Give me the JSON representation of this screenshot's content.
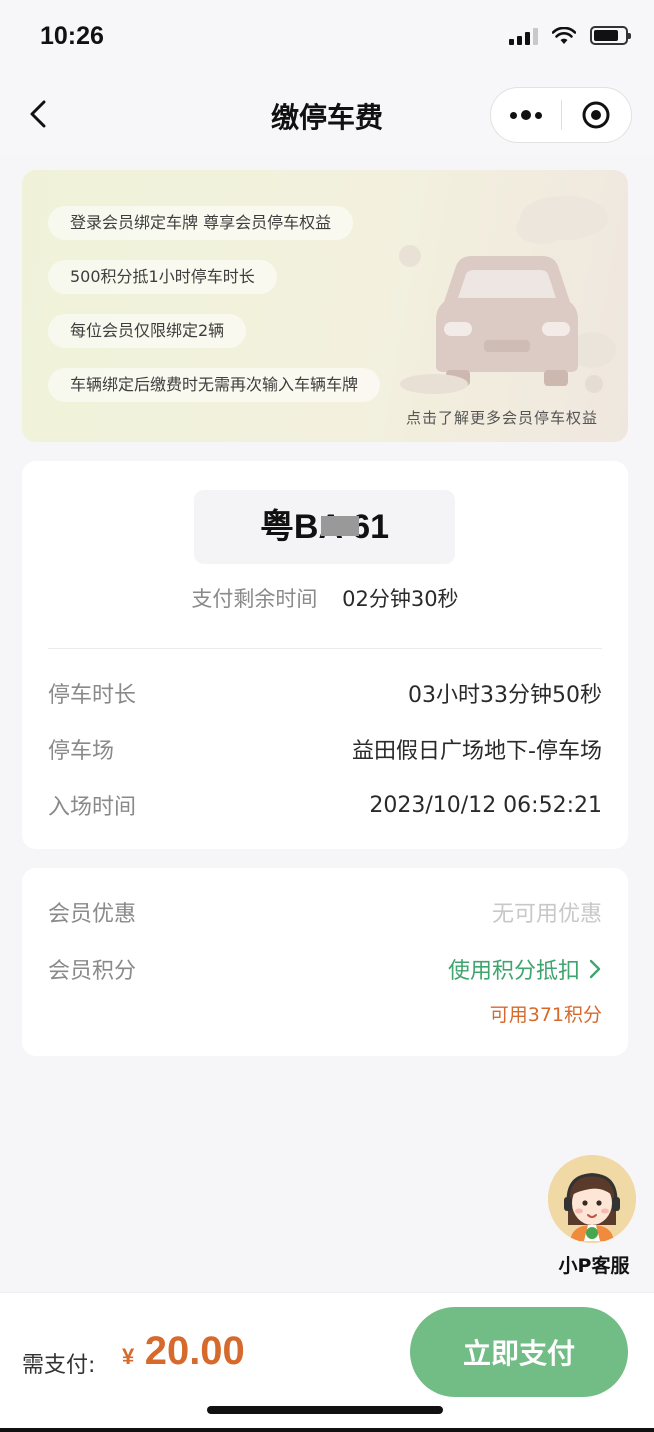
{
  "status_bar": {
    "time": "10:26"
  },
  "nav": {
    "title": "缴停车费"
  },
  "banner": {
    "pills": [
      "登录会员绑定车牌 尊享会员停车权益",
      "500积分抵1小时停车时长",
      "每位会员仅限绑定2辆",
      "车辆绑定后缴费时无需再次输入车辆车牌"
    ],
    "note": "点击了解更多会员停车权益"
  },
  "parking": {
    "plate": "粤BA   61",
    "pay_time_label": "支付剩余时间",
    "pay_time_value": "02分钟30秒",
    "rows": [
      {
        "label": "停车时长",
        "value": "03小时33分钟50秒"
      },
      {
        "label": "停车场",
        "value": "益田假日广场地下-停车场"
      },
      {
        "label": "入场时间",
        "value": "2023/10/12 06:52:21"
      }
    ]
  },
  "member": {
    "discount_label": "会员优惠",
    "discount_value": "无可用优惠",
    "points_label": "会员积分",
    "points_link": "使用积分抵扣",
    "points_available": "可用371积分"
  },
  "service": {
    "label": "小P客服"
  },
  "bottom": {
    "pay_label": "需支付:",
    "currency": "¥",
    "amount": "20.00",
    "pay_button": "立即支付"
  },
  "colors": {
    "accent_green": "#72bc86",
    "link_green": "#3fa56f",
    "price_orange": "#d56a2c"
  }
}
